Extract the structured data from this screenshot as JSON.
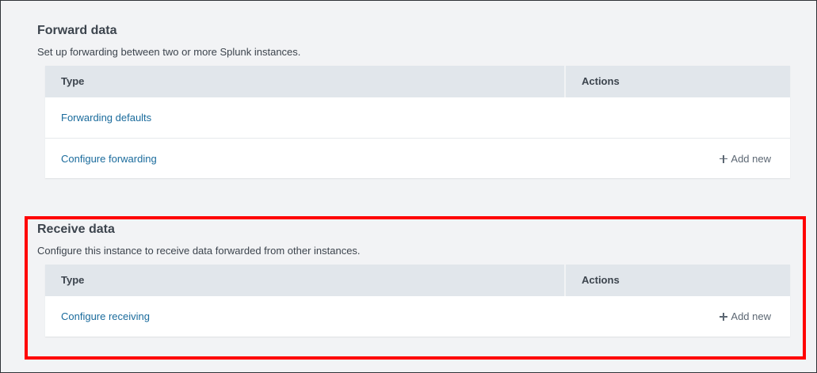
{
  "forward": {
    "title": "Forward data",
    "description": "Set up forwarding between two or more Splunk instances.",
    "columns": {
      "type": "Type",
      "actions": "Actions"
    },
    "rows": [
      {
        "label": "Forwarding defaults",
        "action": ""
      },
      {
        "label": "Configure forwarding",
        "action": "Add new"
      }
    ]
  },
  "receive": {
    "title": "Receive data",
    "description": "Configure this instance to receive data forwarded from other instances.",
    "columns": {
      "type": "Type",
      "actions": "Actions"
    },
    "rows": [
      {
        "label": "Configure receiving",
        "action": "Add new"
      }
    ]
  },
  "icons": {
    "add": "plus-icon"
  },
  "colors": {
    "link": "#1a6b9c",
    "highlight": "#ff0000",
    "header_bg": "#e1e6eb",
    "page_bg": "#f2f3f5"
  }
}
